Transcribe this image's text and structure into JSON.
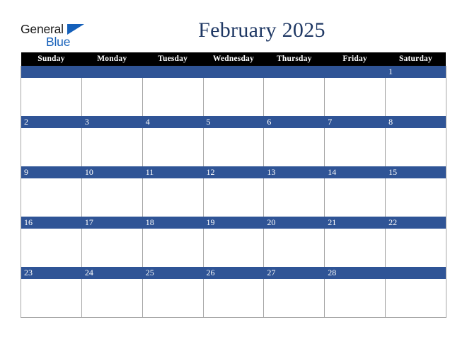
{
  "brand": {
    "logo_line1": "General",
    "logo_line2": "Blue",
    "logo_icon": "blue-triangle-icon",
    "color_dark": "#1a1a1a",
    "color_blue": "#1560ba"
  },
  "header": {
    "title": "February 2025",
    "title_color": "#1f3864"
  },
  "calendar": {
    "month": "February",
    "year": "2025",
    "accent_color": "#2f5496",
    "header_bg": "#000000",
    "grid_line_color": "#a6a6a6",
    "weekday_headers": [
      "Sunday",
      "Monday",
      "Tuesday",
      "Wednesday",
      "Thursday",
      "Friday",
      "Saturday"
    ],
    "weeks": [
      {
        "days": [
          {
            "num": ""
          },
          {
            "num": ""
          },
          {
            "num": ""
          },
          {
            "num": ""
          },
          {
            "num": ""
          },
          {
            "num": ""
          },
          {
            "num": "1"
          }
        ]
      },
      {
        "days": [
          {
            "num": "2"
          },
          {
            "num": "3"
          },
          {
            "num": "4"
          },
          {
            "num": "5"
          },
          {
            "num": "6"
          },
          {
            "num": "7"
          },
          {
            "num": "8"
          }
        ]
      },
      {
        "days": [
          {
            "num": "9"
          },
          {
            "num": "10"
          },
          {
            "num": "11"
          },
          {
            "num": "12"
          },
          {
            "num": "13"
          },
          {
            "num": "14"
          },
          {
            "num": "15"
          }
        ]
      },
      {
        "days": [
          {
            "num": "16"
          },
          {
            "num": "17"
          },
          {
            "num": "18"
          },
          {
            "num": "19"
          },
          {
            "num": "20"
          },
          {
            "num": "21"
          },
          {
            "num": "22"
          }
        ]
      },
      {
        "days": [
          {
            "num": "23"
          },
          {
            "num": "24"
          },
          {
            "num": "25"
          },
          {
            "num": "26"
          },
          {
            "num": "27"
          },
          {
            "num": "28"
          },
          {
            "num": ""
          }
        ]
      }
    ]
  }
}
